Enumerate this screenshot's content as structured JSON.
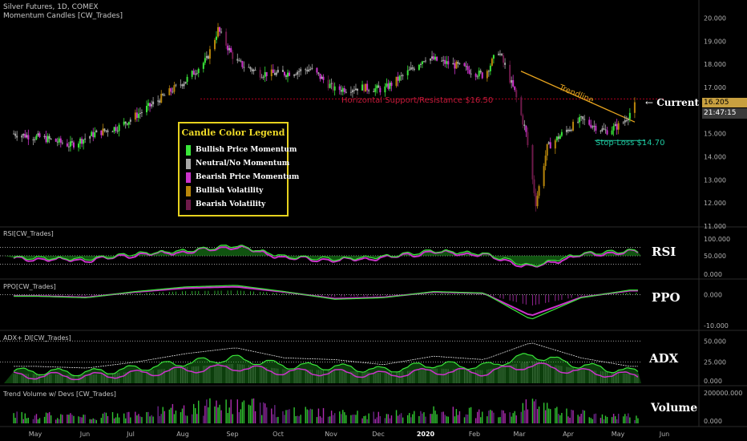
{
  "header": {
    "symbol_line": "Silver Futures, 1D, COMEX",
    "indicator_line": "Momentum Candles [CW_Trades]"
  },
  "colors": {
    "background": "#000000",
    "bullish_momentum": "#39e639",
    "neutral": "#a8a8a8",
    "bearish_momentum": "#cc33cc",
    "bullish_volatility": "#b8860b",
    "bearish_volatility": "#6e1a4a",
    "trendline": "#e6a31e",
    "support_line": "#b00020",
    "stop_loss": "#1ec8a0",
    "legend_border": "#e6d21e",
    "legend_title": "#f0dc28",
    "pane_label": "#ffffff",
    "axis_text": "#b0b0b0",
    "price_badge": "#c8a040",
    "time_badge": "#3a3a3a"
  },
  "price_axis": {
    "ticks": [
      "20.000",
      "19.000",
      "18.000",
      "17.000",
      "16.000",
      "15.000",
      "14.000",
      "13.000",
      "12.000",
      "11.000"
    ],
    "current_price": "16.205",
    "countdown": "21:47:15"
  },
  "time_axis": {
    "labels": [
      "May",
      "Jun",
      "Jul",
      "Aug",
      "Sep",
      "Oct",
      "Nov",
      "Dec",
      "2020",
      "Feb",
      "Mar",
      "Apr",
      "May",
      "Jun"
    ]
  },
  "annotations": {
    "support": "Horizontal Support/Resistance $16.50",
    "trendline": "Trendline",
    "stop_loss": "Stop-Loss $14.70",
    "current": "Current",
    "current_arrow": "←"
  },
  "legend": {
    "title": "Candle Color Legend",
    "items": [
      {
        "label": "Bullish Price Momentum",
        "color": "#39e639"
      },
      {
        "label": "Neutral/No Momentum",
        "color": "#a8a8a8"
      },
      {
        "label": "Bearish Price Momentum",
        "color": "#cc33cc"
      },
      {
        "label": "Bullish Volatility",
        "color": "#b8860b"
      },
      {
        "label": "Bearish Volatility",
        "color": "#6e1a4a"
      }
    ]
  },
  "panes": {
    "rsi": {
      "title": "RSI[CW_Trades]",
      "label": "RSI",
      "ticks": [
        "100.000",
        "50.000",
        "0.000"
      ]
    },
    "ppo": {
      "title": "PPO[CW_Trades]",
      "label": "PPO",
      "ticks": [
        "0.000",
        "-10.000"
      ]
    },
    "adx": {
      "title": "ADX+ DI[CW_Trades]",
      "label": "ADX",
      "ticks": [
        "50.000",
        "25.000",
        "0.000"
      ]
    },
    "volume": {
      "title": "Trend Volume w/ Devs [CW_Trades]",
      "label": "Volume",
      "ticks": [
        "200000.000",
        "0.000"
      ]
    }
  },
  "chart_data": [
    {
      "type": "candlestick",
      "title": "Silver Futures, 1D, COMEX",
      "x": [
        "2019-05-01",
        "2019-05-20",
        "2019-06-05",
        "2019-06-20",
        "2019-07-05",
        "2019-07-20",
        "2019-08-01",
        "2019-08-15",
        "2019-08-28",
        "2019-09-04",
        "2019-09-15",
        "2019-09-30",
        "2019-10-15",
        "2019-10-31",
        "2019-11-15",
        "2019-12-01",
        "2019-12-15",
        "2019-12-31",
        "2020-01-10",
        "2020-01-20",
        "2020-01-31",
        "2020-02-15",
        "2020-02-24",
        "2020-03-05",
        "2020-03-12",
        "2020-03-18",
        "2020-03-25",
        "2020-04-05",
        "2020-04-15",
        "2020-04-30",
        "2020-05-10",
        "2020-05-18"
      ],
      "close": [
        15.0,
        14.8,
        14.5,
        15.0,
        15.3,
        16.0,
        16.6,
        17.3,
        18.2,
        19.5,
        18.1,
        17.6,
        17.6,
        17.8,
        16.9,
        17.0,
        16.9,
        17.7,
        18.3,
        18.1,
        17.9,
        17.5,
        18.6,
        16.8,
        15.0,
        12.0,
        14.4,
        15.1,
        15.6,
        15.1,
        15.4,
        16.205
      ],
      "ylim": [
        11.0,
        20.5
      ],
      "ylabel": "",
      "current": 16.205,
      "support_level": 16.5,
      "stop_loss": 14.7
    },
    {
      "type": "line",
      "title": "RSI[CW_Trades]",
      "ylim": [
        0,
        100
      ],
      "reference_lines": [
        70,
        50,
        30
      ],
      "x": [
        "2019-05",
        "2019-06",
        "2019-07",
        "2019-08",
        "2019-09",
        "2019-10",
        "2019-11",
        "2019-12",
        "2020-01",
        "2020-02",
        "2020-03",
        "2020-04",
        "2020-05"
      ],
      "series": [
        {
          "values": [
            45,
            42,
            55,
            62,
            75,
            48,
            42,
            48,
            62,
            55,
            25,
            55,
            62
          ]
        }
      ]
    },
    {
      "type": "line",
      "title": "PPO[CW_Trades]",
      "ylim": [
        -11,
        4
      ],
      "reference_lines": [
        0
      ],
      "x": [
        "2019-05",
        "2019-06",
        "2019-07",
        "2019-08",
        "2019-09",
        "2019-10",
        "2019-11",
        "2019-12",
        "2020-01",
        "2020-02",
        "2020-03",
        "2020-04",
        "2020-05"
      ],
      "series": [
        {
          "values": [
            -0.5,
            -1,
            1,
            2.5,
            3,
            1,
            -1.5,
            -1,
            1,
            0.5,
            -8,
            -1,
            1.5
          ]
        }
      ]
    },
    {
      "type": "area",
      "title": "ADX+ DI[CW_Trades]",
      "ylim": [
        0,
        55
      ],
      "reference_lines": [
        50,
        25
      ],
      "x": [
        "2019-05",
        "2019-06",
        "2019-07",
        "2019-08",
        "2019-09",
        "2019-10",
        "2019-11",
        "2019-12",
        "2020-01",
        "2020-02",
        "2020-03",
        "2020-04",
        "2020-05"
      ],
      "series": [
        {
          "values": [
            20,
            18,
            25,
            35,
            42,
            30,
            28,
            22,
            32,
            28,
            48,
            30,
            20
          ]
        }
      ]
    },
    {
      "type": "bar",
      "title": "Trend Volume w/ Devs [CW_Trades]",
      "ylim": [
        0,
        200000
      ],
      "x": [
        "2019-05",
        "2019-06",
        "2019-07",
        "2019-08",
        "2019-09",
        "2019-10",
        "2019-11",
        "2019-12",
        "2020-01",
        "2020-02",
        "2020-03",
        "2020-04",
        "2020-05"
      ],
      "series": [
        {
          "values": [
            60000,
            50000,
            70000,
            110000,
            150000,
            90000,
            80000,
            60000,
            90000,
            80000,
            130000,
            70000,
            50000
          ]
        }
      ]
    }
  ]
}
